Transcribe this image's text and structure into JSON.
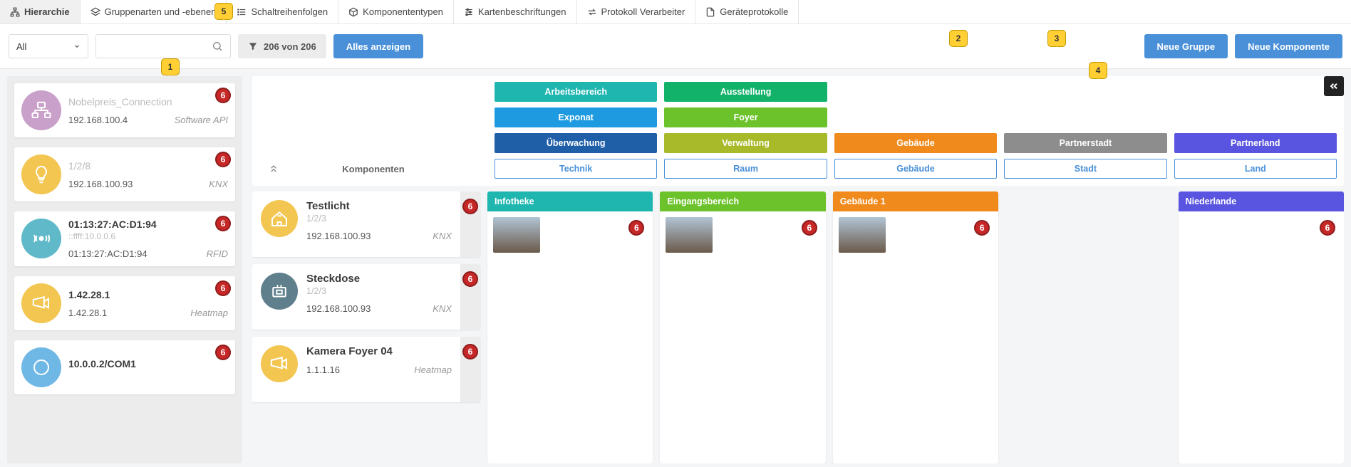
{
  "topnav": [
    {
      "label": "Hierarchie",
      "active": true
    },
    {
      "label": "Gruppenarten und -ebenen"
    },
    {
      "label": "Schaltreihenfolgen"
    },
    {
      "label": "Komponententypen"
    },
    {
      "label": "Kartenbeschriftungen"
    },
    {
      "label": "Protokoll Verarbeiter"
    },
    {
      "label": "Geräteprotokolle"
    }
  ],
  "toolbar": {
    "select_all": "All",
    "filter": "206 von 206",
    "show_all": "Alles anzeigen",
    "new_group": "Neue Gruppe",
    "new_component": "Neue Komponente"
  },
  "left_list": [
    {
      "title": "Nobelpreis_Connection",
      "muted": true,
      "sub": "",
      "addr": "192.168.100.4",
      "type": "Software API",
      "icon": "network",
      "color": "#c9a0c9",
      "badge": "6"
    },
    {
      "title": "1/2/8",
      "muted": true,
      "sub": "",
      "addr": "192.168.100.93",
      "type": "KNX",
      "icon": "bulb",
      "color": "#f3c651",
      "badge": "6"
    },
    {
      "title": "01:13:27:AC:D1:94",
      "muted": false,
      "sub": "::ffff:10.0.0.6",
      "addr": "01:13:27:AC:D1:94",
      "type": "RFID",
      "icon": "rfid",
      "color": "#5fb9c9",
      "badge": "6"
    },
    {
      "title": "1.42.28.1",
      "muted": false,
      "sub": "",
      "addr": "1.42.28.1",
      "type": "Heatmap",
      "icon": "camera",
      "color": "#f3c651",
      "badge": "6"
    },
    {
      "title": "10.0.0.2/COM1",
      "muted": false,
      "sub": "",
      "addr": "",
      "type": "",
      "icon": "generic",
      "color": "#6fb8e6",
      "badge": "6"
    }
  ],
  "komp_header_label": "Komponenten",
  "chips": {
    "col1": [
      {
        "label": "Arbeitsbereich",
        "bg": "#1fb6b0"
      },
      {
        "label": "Exponat",
        "bg": "#1e9be0"
      },
      {
        "label": "Überwachung",
        "bg": "#1f5fa8"
      },
      {
        "label": "Technik",
        "outline": true
      }
    ],
    "col2": [
      {
        "label": "Ausstellung",
        "bg": "#13b26b"
      },
      {
        "label": "Foyer",
        "bg": "#6cc22a"
      },
      {
        "label": "Verwaltung",
        "bg": "#a8b92a"
      },
      {
        "label": "Raum",
        "outline": true
      }
    ],
    "col3": [
      {
        "label": "Gebäude",
        "bg": "#f08a1d"
      },
      {
        "label": "Gebäude",
        "outline": true
      }
    ],
    "col4": [
      {
        "label": "Partnerstadt",
        "bg": "#8d8d8d"
      },
      {
        "label": "Stadt",
        "outline": true
      }
    ],
    "col5": [
      {
        "label": "Partnerland",
        "bg": "#5a55e0"
      },
      {
        "label": "Land",
        "outline": true
      }
    ]
  },
  "komp_cards": [
    {
      "title": "Testlicht",
      "sub": "1/2/3",
      "addr": "192.168.100.93",
      "type": "KNX",
      "icon": "house-plug",
      "color": "#f3c651",
      "badge": "6"
    },
    {
      "title": "Steckdose",
      "sub": "1/2/3",
      "addr": "192.168.100.93",
      "type": "KNX",
      "icon": "plug",
      "color": "#5f7f8c",
      "badge": "6"
    },
    {
      "title": "Kamera Foyer 04",
      "sub": "",
      "addr": "1.1.1.16",
      "type": "Heatmap",
      "icon": "camera",
      "color": "#f3c651",
      "badge": "6"
    }
  ],
  "group_cols": [
    {
      "title": "Infotheke",
      "bg": "#1fb6b0",
      "badge": "6",
      "thumb": true
    },
    {
      "title": "Eingangsbereich",
      "bg": "#6cc22a",
      "badge": "6",
      "thumb": true
    },
    {
      "title": "Gebäude 1",
      "bg": "#f08a1d",
      "badge": "6",
      "thumb": true
    },
    {
      "title": "",
      "bg": "",
      "badge": "",
      "thumb": false
    },
    {
      "title": "Niederlande",
      "bg": "#5a55e0",
      "badge": "6",
      "thumb": false
    }
  ],
  "callouts": {
    "1": "1",
    "2": "2",
    "3": "3",
    "4": "4",
    "5": "5"
  }
}
